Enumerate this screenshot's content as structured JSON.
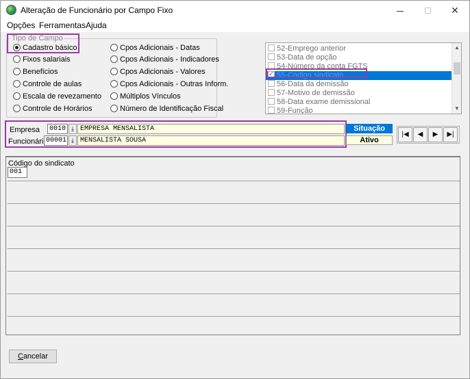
{
  "window": {
    "title": "Alteração de Funcionário por Campo Fixo"
  },
  "menu": [
    "Opções",
    "Ferramentas",
    "Ajuda"
  ],
  "tipo_campo": {
    "legend": "Tipo de Campo",
    "selected": "Cadastro básico",
    "col1": [
      "Cadastro básico",
      "Fixos salariais",
      "Benefícios",
      "Controle de aulas",
      "Escala de revezamento",
      "Controle de Horários"
    ],
    "col2": [
      "Cpos Adicionais - Datas",
      "Cpos Adicionais - Indicadores",
      "Cpos Adicionais - Valores",
      "Cpos Adicionais - Outras Inform.",
      "Múltiplos Vínculos",
      "Número de Identificação Fiscal"
    ]
  },
  "field_list": {
    "items": [
      "52-Emprego anterior",
      "53-Data de opção",
      "54-Número da conta FGTS",
      "55-Código sindicato",
      "56-Data da demissão",
      "57-Motivo de demissão",
      "58-Data exame demissional",
      "59-Função"
    ],
    "selected_index": 3
  },
  "empresa": {
    "label": "Empresa",
    "code": "0010",
    "name": "EMPRESA MENSALISTA"
  },
  "funcionario": {
    "label": "Funcionário",
    "code": "00001",
    "name": "MENSALISTA SOUSA"
  },
  "situacao": {
    "header": "Situação",
    "value": "Ativo"
  },
  "nav": {
    "first": "first-icon",
    "prev": "prev-icon",
    "next": "next-icon",
    "last": "last-icon"
  },
  "grid": {
    "field_label": "Código do sindicato",
    "field_value": "001"
  },
  "cancel_label": "Cancelar",
  "colors": {
    "accent": "#0078d7",
    "highlight": "#9b3aa5",
    "input_yellow": "#ffffe1"
  }
}
